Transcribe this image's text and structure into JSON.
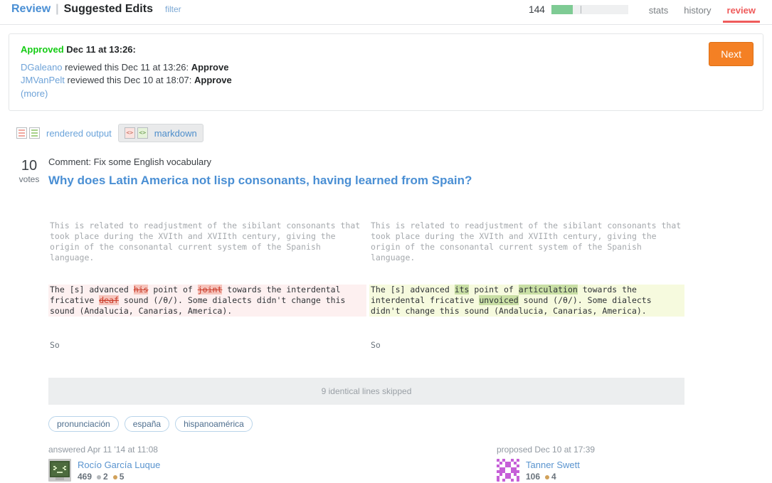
{
  "header": {
    "review_link": "Review",
    "separator": "|",
    "title": "Suggested Edits",
    "filter_link": "filter",
    "progress_count": "144",
    "progress_fill_pct": 28,
    "progress_tick_pct": 38,
    "nav": [
      {
        "label": "stats",
        "active": false
      },
      {
        "label": "history",
        "active": false
      },
      {
        "label": "review",
        "active": true
      }
    ],
    "accent_color": "#ef5b5b"
  },
  "notice": {
    "status": "Approved",
    "status_color": "#14cc14",
    "status_time": "Dec 11 at 13:26:",
    "reviews": [
      {
        "user": "DGaleano",
        "text": " reviewed this Dec 11 at 13:26: ",
        "decision": "Approve"
      },
      {
        "user": "JMVanPelt",
        "text": " reviewed this Dec 10 at 18:07: ",
        "decision": "Approve"
      }
    ],
    "more_label": "(more)",
    "next_label": "Next",
    "next_color": "#f48024"
  },
  "view_toggle": {
    "rendered_label": "rendered output",
    "markdown_label": "markdown",
    "selected": "markdown",
    "code_glyph": "<>"
  },
  "post": {
    "votes_number": "10",
    "votes_label": "votes",
    "comment": "Comment: Fix some English vocabulary",
    "title": "Why does Latin America not lisp consonants, having learned from Spain?"
  },
  "diff": {
    "left": {
      "context": "This is related to readjustment of the sibilant consonants that took place during the XVIth and XVIIth century, giving the origin of the consonantal current system of the Spanish language.",
      "changed": [
        {
          "t": "The [s] advanced ",
          "h": false
        },
        {
          "t": "his",
          "h": true
        },
        {
          "t": " point of ",
          "h": false
        },
        {
          "t": "joint",
          "h": true
        },
        {
          "t": " towards the interdental fricative ",
          "h": false
        },
        {
          "t": "deaf",
          "h": true
        },
        {
          "t": " sound (/θ/). Some dialects didn't change this sound (Andalucia, Canarias, America).",
          "h": false
        }
      ],
      "plain": "So"
    },
    "right": {
      "context": "This is related to readjustment of the sibilant consonants that took place during the XVIth and XVIIth century, giving the origin of the consonantal current system of the Spanish language.",
      "changed": [
        {
          "t": "The [s] advanced ",
          "h": false
        },
        {
          "t": "its",
          "h": true
        },
        {
          "t": " point of ",
          "h": false
        },
        {
          "t": "articulation",
          "h": true
        },
        {
          "t": " towards the interdental fricative ",
          "h": false
        },
        {
          "t": "unvoiced",
          "h": true
        },
        {
          "t": " sound (/θ/). Some dialects didn't change this sound (Andalucia, Canarias, America).",
          "h": false
        }
      ],
      "plain": "So"
    },
    "skipped_label": "9 identical lines skipped"
  },
  "tags": [
    "pronunciación",
    "españa",
    "hispanoamérica"
  ],
  "cards": {
    "answer": {
      "meta": "answered Apr 11 '14 at 11:08",
      "username": "Rocío García Luque",
      "reputation": "469",
      "badges": [
        {
          "type": "silver",
          "count": "2"
        },
        {
          "type": "bronze",
          "count": "5"
        }
      ]
    },
    "proposal": {
      "meta": "proposed Dec 10 at 17:39",
      "username": "Tanner Swett",
      "reputation": "106",
      "badges": [
        {
          "type": "bronze",
          "count": "4"
        }
      ]
    }
  }
}
